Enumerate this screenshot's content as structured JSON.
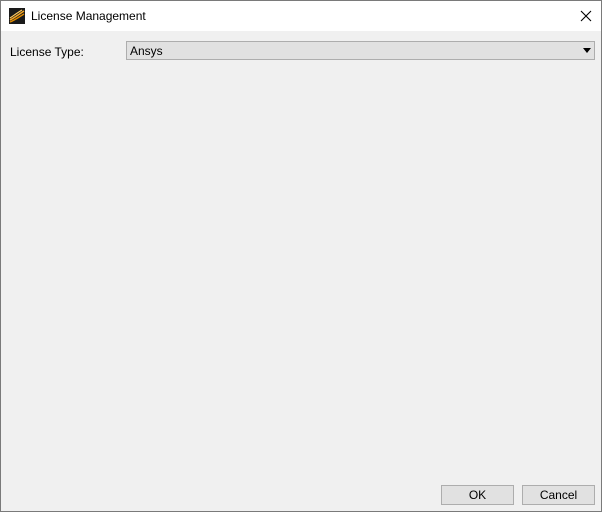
{
  "window": {
    "title": "License Management",
    "icon": "ansys-logo-icon",
    "close_icon": "close-icon"
  },
  "form": {
    "license_type_label": "License Type:",
    "license_type_value": "Ansys"
  },
  "buttons": {
    "ok_label": "OK",
    "cancel_label": "Cancel"
  },
  "colors": {
    "dialog_background": "#f0f0f0",
    "titlebar_background": "#ffffff",
    "control_background": "#e1e1e1",
    "control_border": "#adadad",
    "icon_orange": "#f5a623"
  }
}
